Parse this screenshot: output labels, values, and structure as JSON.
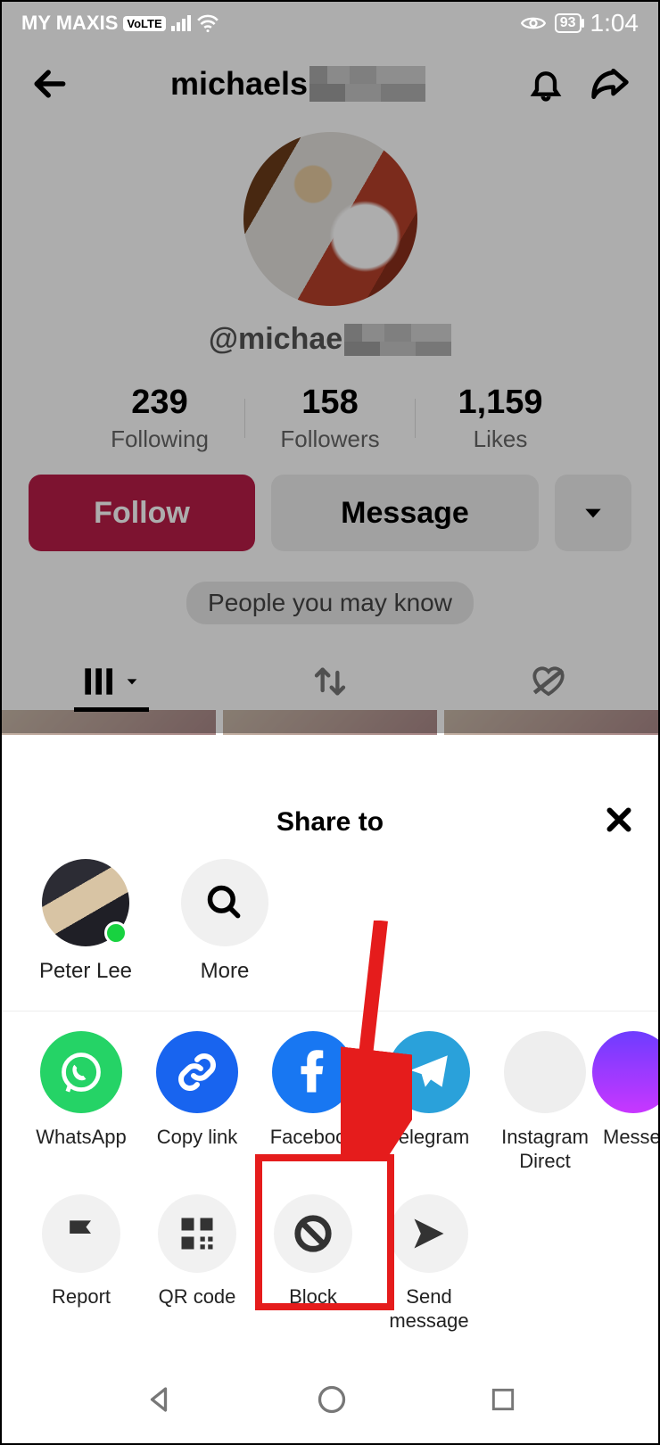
{
  "status": {
    "carrier": "MY MAXIS",
    "volte": "VoLTE",
    "battery": "93",
    "time": "1:04"
  },
  "header": {
    "name_visible": "michaels",
    "username_visible": "@michae"
  },
  "stats": {
    "following_num": "239",
    "following_lbl": "Following",
    "followers_num": "158",
    "followers_lbl": "Followers",
    "likes_num": "1,159",
    "likes_lbl": "Likes"
  },
  "actions": {
    "follow": "Follow",
    "message": "Message"
  },
  "suggest_chip": "People you may know",
  "sheet": {
    "title": "Share to",
    "contact1": "Peter Lee",
    "more": "More"
  },
  "apps": {
    "whatsapp": "WhatsApp",
    "copylink": "Copy link",
    "facebook": "Facebook",
    "telegram": "Telegram",
    "instagram": "Instagram Direct",
    "messenger": "Messenger"
  },
  "actions_row": {
    "report": "Report",
    "qr": "QR code",
    "block": "Block",
    "send": "Send message"
  }
}
